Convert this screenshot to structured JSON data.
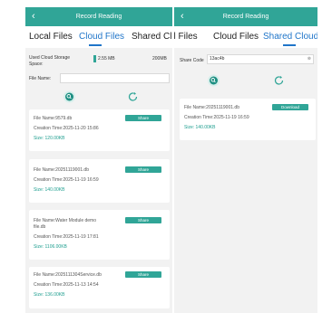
{
  "left": {
    "header": {
      "back_icon": "chevron-left-icon",
      "title": "Record Reading"
    },
    "tabs": [
      {
        "label": "Local Files"
      },
      {
        "label": "Cloud Files"
      },
      {
        "label": "Shared Clo"
      }
    ],
    "storage": {
      "label_line1": "Used Cloud Storage",
      "label_line2": "Space:",
      "used": "2.55 MB",
      "total": "200MB",
      "used_fraction": 0.013
    },
    "file_name_label": "File Name:",
    "file_name_value": "",
    "cards": [
      {
        "name": "File Name:9579.db",
        "time": "Creation Time:2025-11-20 15:86",
        "size": "Size: 120.00KB",
        "button": "Share"
      },
      {
        "name": "File Name:20251119001.db",
        "time": "Creation Time:2025-11-19 16:59",
        "size": "Size: 140.00KB",
        "button": "Share"
      },
      {
        "name": "File Name:Water Module demo file.db",
        "time": "Creation Time:2025-11-19 17:81",
        "size": "Size: 1106.00KB",
        "button": "Share"
      },
      {
        "name": "File Name:2025111304Service.db",
        "time": "Creation Time:2025-11-13 14:54",
        "size": "Size: 136.00KB",
        "button": "Share"
      }
    ],
    "accent": "#30a597"
  },
  "right": {
    "header": {
      "back_icon": "chevron-left-icon",
      "title": "Record Reading"
    },
    "tabs": [
      {
        "label": "al Files"
      },
      {
        "label": "Cloud Files"
      },
      {
        "label": "Shared Cloud"
      }
    ],
    "share_code_label": "Share Code",
    "share_code_value": "13ac4b",
    "clear_icon": "clear-icon",
    "card": {
      "name": "File Name:20251119001.db",
      "time": "Creation Time:2025-11-19 16:59",
      "size": "Size: 140.00KB",
      "button": "Download"
    }
  }
}
